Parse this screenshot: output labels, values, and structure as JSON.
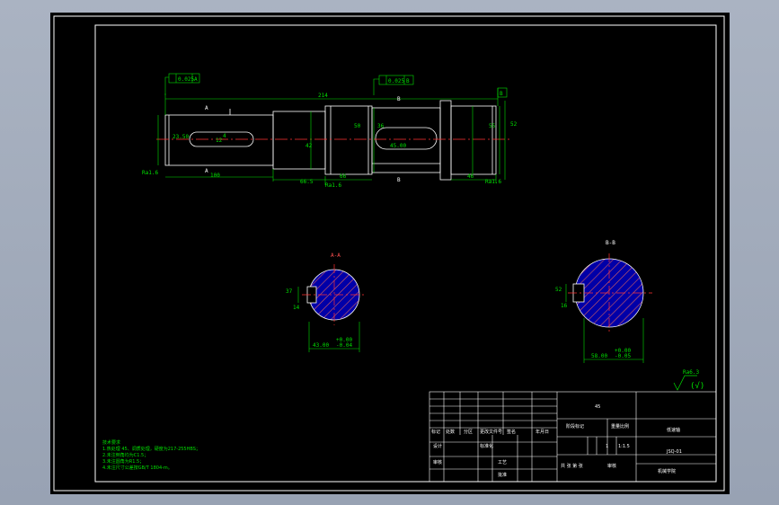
{
  "drawing": {
    "geometric_tolerance_left": "0.025",
    "geometric_tolerance_left_datum": "A",
    "geometric_tolerance_mid": "0.025",
    "geometric_tolerance_mid_datum": "B",
    "datum_a": "A",
    "datum_b": "B",
    "datum_box_right": "B",
    "section_a_label": "A-A",
    "section_b_label": "B-B",
    "section_cut_a": "A",
    "section_cut_b": "B",
    "dims": {
      "overall_length": "214",
      "left_shaft_length": "100",
      "left_dia": "42",
      "keyway_length": "23.50",
      "key_width": "12",
      "key_offset": "4",
      "mid_len_a": "66.5",
      "mid_len_b": "66",
      "right_len": "46",
      "right_keyway": "45.00",
      "right_dia": "52",
      "shoulder_dia": "55",
      "mid_dia": "50",
      "step_a": "36",
      "roughness_a": "Ra1.6",
      "roughness_b": "Ra1.6",
      "roughness_c": "Ra1.6",
      "sec_a_dim1": "37",
      "sec_a_dim2": "14",
      "sec_a_width": "43.00",
      "sec_a_tol_up": "+0.00",
      "sec_a_tol_dn": "-0.04",
      "sec_b_dim1": "52",
      "sec_b_dim2": "16",
      "sec_b_width": "58.00",
      "sec_b_tol_up": "+0.00",
      "sec_b_tol_dn": "-0.05",
      "roughness_general": "Ra6.3"
    },
    "notes": {
      "title": "技术要求",
      "line1": "1.热处理 45、调质处理，硬度为217-255HBS；",
      "line2": "2.未注倒角均为C1.5；",
      "line3": "3.未注圆角为R1.5；",
      "line4": "4.未注尺寸公差按GB/T 1804-m。"
    }
  },
  "title_block": {
    "material": "45",
    "part_name": "低速轴",
    "drawing_no": "JSQ-01",
    "school": "机械学院",
    "scale_label": "比例",
    "scale": "1:1.5",
    "weight_label": "重量",
    "qty": "1",
    "stage_label": "阶段标记",
    "mark_label": "标记",
    "count_label": "处数",
    "zone_label": "分区",
    "change_label": "更改文件号",
    "sign_label": "签名",
    "date_label": "年月日",
    "design_label": "设计",
    "standard_label": "标准化",
    "check_label": "审核",
    "process_label": "工艺",
    "approve_label": "批准",
    "sheet_label": "共 张  第 张",
    "review_label": "审核"
  }
}
